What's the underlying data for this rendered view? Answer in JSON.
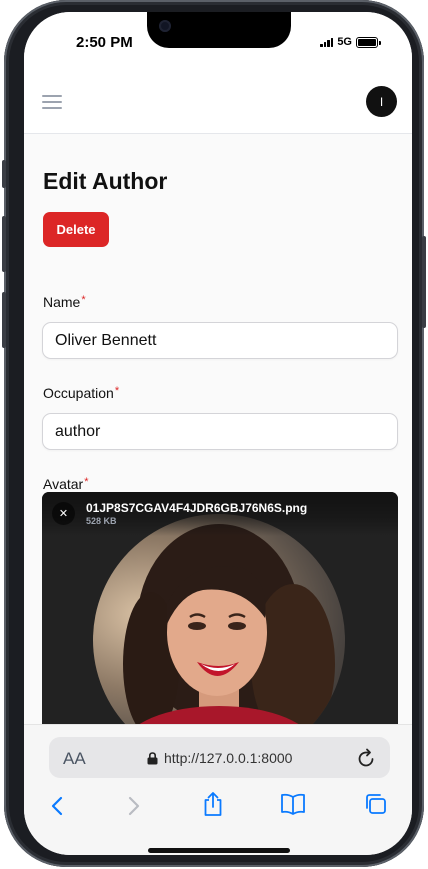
{
  "status_bar": {
    "time": "2:50 PM",
    "network": "5G"
  },
  "header": {
    "avatar_initial": "I"
  },
  "page": {
    "title": "Edit Author",
    "delete_label": "Delete"
  },
  "form": {
    "name": {
      "label": "Name",
      "required_mark": "*",
      "value": "Oliver Bennett"
    },
    "occupation": {
      "label": "Occupation",
      "required_mark": "*",
      "value": "author"
    },
    "avatar": {
      "label": "Avatar",
      "required_mark": "*",
      "file_name": "01JP8S7CGAV4F4JDR6GBJ76N6S.png",
      "file_size": "528 KB",
      "remove_symbol": "✕"
    }
  },
  "browser": {
    "text_size_label": "AA",
    "url": "http://127.0.0.1:8000"
  },
  "colors": {
    "danger": "#dc2626",
    "ios_blue": "#0a7aff",
    "dark": "#111111"
  },
  "icons": [
    "menu-icon",
    "lock-icon",
    "reload-icon",
    "back-icon",
    "forward-icon",
    "share-icon",
    "bookmarks-icon",
    "tabs-icon",
    "close-icon"
  ]
}
